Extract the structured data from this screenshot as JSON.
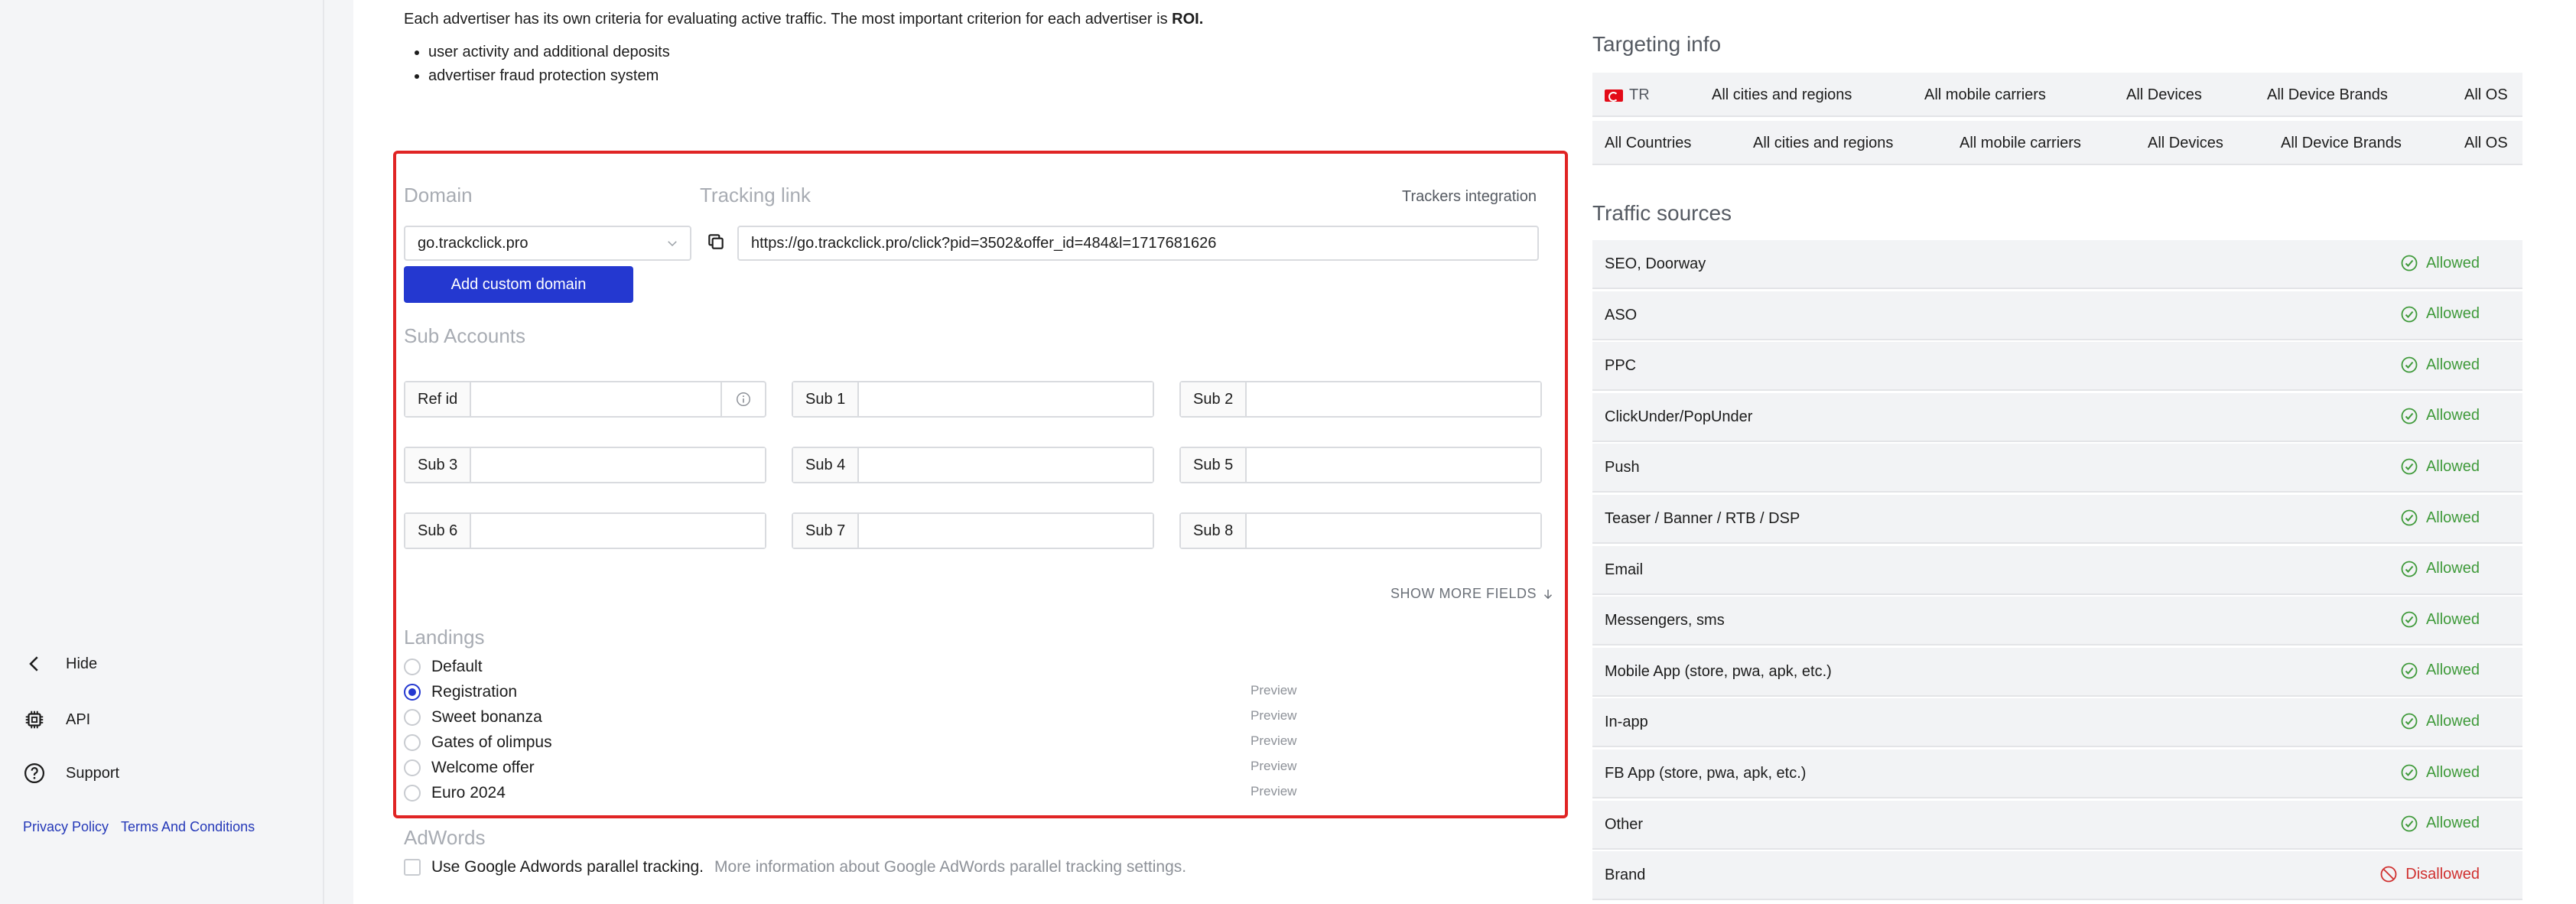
{
  "sidebar": {
    "hide_label": "Hide",
    "api_label": "API",
    "support_label": "Support",
    "privacy_label": "Privacy Policy",
    "terms_label": "Terms And Conditions"
  },
  "intro": {
    "text": "Each advertiser has its own criteria for evaluating active traffic. The most important criterion for each advertiser is",
    "emphasis": "ROI.",
    "bullets": [
      "user activity and additional deposits",
      "advertiser fraud protection system"
    ]
  },
  "tracking": {
    "domain_label": "Domain",
    "tracking_link_label": "Tracking link",
    "trackers_integration_label": "Trackers integration",
    "domain_value": "go.trackclick.pro",
    "tracking_link_value": "https://go.trackclick.pro/click?pid=3502&offer_id=484&l=1717681626",
    "add_domain_label": "Add custom domain",
    "sub_accounts_label": "Sub Accounts",
    "fields": {
      "ref_id": "Ref id",
      "sub1": "Sub 1",
      "sub2": "Sub 2",
      "sub3": "Sub 3",
      "sub4": "Sub 4",
      "sub5": "Sub 5",
      "sub6": "Sub 6",
      "sub7": "Sub 7",
      "sub8": "Sub 8"
    },
    "show_more_label": "SHOW MORE FIELDS",
    "landings_label": "Landings",
    "preview_label": "Preview",
    "landings": [
      {
        "label": "Default",
        "selected": false
      },
      {
        "label": "Registration",
        "selected": true
      },
      {
        "label": "Sweet bonanza",
        "selected": false
      },
      {
        "label": "Gates of olimpus",
        "selected": false
      },
      {
        "label": "Welcome offer",
        "selected": false
      },
      {
        "label": "Euro 2024",
        "selected": false
      }
    ]
  },
  "adwords": {
    "label": "AdWords",
    "checkbox_text": "Use Google Adwords parallel tracking.",
    "more_info": "More information about Google AdWords parallel tracking settings."
  },
  "targeting": {
    "title": "Targeting info",
    "rows": [
      {
        "country": "TR",
        "cities": "All cities and regions",
        "carriers": "All mobile carriers",
        "devices": "All Devices",
        "brands": "All Device Brands",
        "os": "All OS"
      },
      {
        "country": "All Countries",
        "cities": "All cities and regions",
        "carriers": "All mobile carriers",
        "devices": "All Devices",
        "brands": "All Device Brands",
        "os": "All OS"
      }
    ]
  },
  "traffic_sources": {
    "title": "Traffic sources",
    "colors": {
      "allowed": "#3f9a3a",
      "disallowed": "#d0302f"
    },
    "items": [
      {
        "name": "SEO, Doorway",
        "status": "Allowed"
      },
      {
        "name": "ASO",
        "status": "Allowed"
      },
      {
        "name": "PPC",
        "status": "Allowed"
      },
      {
        "name": "ClickUnder/PopUnder",
        "status": "Allowed"
      },
      {
        "name": "Push",
        "status": "Allowed"
      },
      {
        "name": "Teaser / Banner / RTB / DSP",
        "status": "Allowed"
      },
      {
        "name": "Email",
        "status": "Allowed"
      },
      {
        "name": "Messengers, sms",
        "status": "Allowed"
      },
      {
        "name": "Mobile App (store, pwa, apk, etc.)",
        "status": "Allowed"
      },
      {
        "name": "In-app",
        "status": "Allowed"
      },
      {
        "name": "FB App (store, pwa, apk, etc.)",
        "status": "Allowed"
      },
      {
        "name": "Other",
        "status": "Allowed"
      },
      {
        "name": "Brand",
        "status": "Disallowed"
      }
    ]
  }
}
